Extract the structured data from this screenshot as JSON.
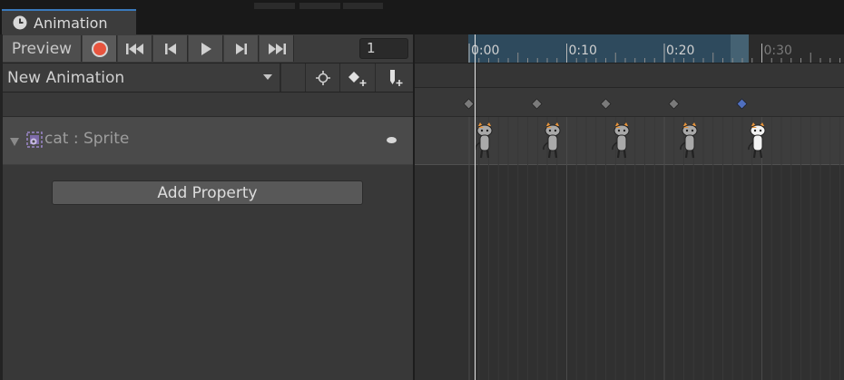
{
  "window": {
    "tab_title": "Animation"
  },
  "toolbar": {
    "preview_label": "Preview",
    "frame_value": "1",
    "buttons": {
      "record": "record-icon",
      "first_key": "skip-to-start-icon",
      "prev_key": "prev-frame-icon",
      "play": "play-icon",
      "next_key": "next-frame-icon",
      "last_key": "skip-to-end-icon"
    }
  },
  "clip": {
    "selected": "New Animation",
    "buttons": [
      "filter-by-selection-icon",
      "add-keyframe-icon",
      "add-event-icon"
    ]
  },
  "properties": [
    {
      "label": "cat : Sprite",
      "expanded": true
    }
  ],
  "add_property_label": "Add Property",
  "timeline": {
    "ruler_labels": [
      "0:00",
      "0:10",
      "0:20",
      "0:30"
    ],
    "playhead_time": "0:00",
    "keyframe_times": [
      "0:00",
      "0:07",
      "0:14",
      "0:21",
      "0:28"
    ],
    "selected_keyframe": 4
  },
  "colors": {
    "accent_tab": "#3a79bb",
    "record_red": "#e8553f",
    "selected_key": "#4f6fbf",
    "key": "#7a7a7a",
    "range": "#2e4a5d"
  }
}
